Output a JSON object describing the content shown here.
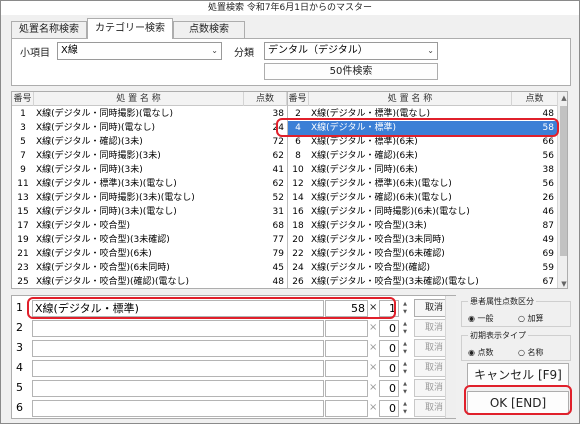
{
  "window": {
    "title": "処置検索 令和7年6月1日からのマスター"
  },
  "tabs": [
    {
      "label": "処置名称検索"
    },
    {
      "label": "カテゴリー検索"
    },
    {
      "label": "点数検索"
    }
  ],
  "filters": {
    "subitem_label": "小項目",
    "subitem_value": "X線",
    "category_label": "分類",
    "category_value": "デンタル（デジタル）",
    "search_button": "50件検索"
  },
  "table": {
    "headers": {
      "no": "番号",
      "name": "処 置 名 称",
      "pts": "点数"
    },
    "left_rows": [
      {
        "no": "1",
        "name": "X線(デジタル・同時撮影)(電なし)",
        "pts": "38"
      },
      {
        "no": "3",
        "name": "X線(デジタル・同時)(電なし)",
        "pts": "24"
      },
      {
        "no": "5",
        "name": "X線(デジタル・確認)(3未)",
        "pts": "72"
      },
      {
        "no": "7",
        "name": "X線(デジタル・同時撮影)(3未)",
        "pts": "62"
      },
      {
        "no": "9",
        "name": "X線(デジタル・同時)(3未)",
        "pts": "41"
      },
      {
        "no": "11",
        "name": "X線(デジタル・標準)(3未)(電なし)",
        "pts": "62"
      },
      {
        "no": "13",
        "name": "X線(デジタル・同時撮影)(3未)(電なし)",
        "pts": "52"
      },
      {
        "no": "15",
        "name": "X線(デジタル・同時)(3未)(電なし)",
        "pts": "31"
      },
      {
        "no": "17",
        "name": "X線(デジタル・咬合型)",
        "pts": "68"
      },
      {
        "no": "19",
        "name": "X線(デジタル・咬合型)(3未確認)",
        "pts": "77"
      },
      {
        "no": "21",
        "name": "X線(デジタル・咬合型)(6未)",
        "pts": "79"
      },
      {
        "no": "23",
        "name": "X線(デジタル・咬合型)(6未同時)",
        "pts": "45"
      },
      {
        "no": "25",
        "name": "X線(デジタル・咬合型)(確認)(電なし)",
        "pts": "48"
      }
    ],
    "right_rows": [
      {
        "no": "2",
        "name": "X線(デジタル・標準)(電なし)",
        "pts": "48"
      },
      {
        "no": "4",
        "name": "X線(デジタル・標準)",
        "pts": "58"
      },
      {
        "no": "6",
        "name": "X線(デジタル・標準)(6未)",
        "pts": "66"
      },
      {
        "no": "8",
        "name": "X線(デジタル・確認)(6未)",
        "pts": "56"
      },
      {
        "no": "10",
        "name": "X線(デジタル・同時)(6未)",
        "pts": "38"
      },
      {
        "no": "12",
        "name": "X線(デジタル・標準)(6未)(電なし)",
        "pts": "56"
      },
      {
        "no": "14",
        "name": "X線(デジタル・確認)(6未)(電なし)",
        "pts": "26"
      },
      {
        "no": "16",
        "name": "X線(デジタル・同時撮影)(6未)(電なし)",
        "pts": "46"
      },
      {
        "no": "18",
        "name": "X線(デジタル・咬合型)(3未)",
        "pts": "87"
      },
      {
        "no": "20",
        "name": "X線(デジタル・咬合型)(3未同時)",
        "pts": "49"
      },
      {
        "no": "22",
        "name": "X線(デジタル・咬合型)(6未確認)",
        "pts": "69"
      },
      {
        "no": "24",
        "name": "X線(デジタル・咬合型)(確認)",
        "pts": "59"
      },
      {
        "no": "26",
        "name": "X線(デジタル・咬合型)(3未確認)(電なし)",
        "pts": "67"
      }
    ]
  },
  "input_rows": [
    {
      "idx": "1",
      "name": "X線(デジタル・標準)",
      "pts": "58",
      "x": "×",
      "qty": "1",
      "cancel": "取消"
    },
    {
      "idx": "2",
      "name": "",
      "pts": "",
      "x": "×",
      "qty": "0",
      "cancel": "取消"
    },
    {
      "idx": "3",
      "name": "",
      "pts": "",
      "x": "×",
      "qty": "0",
      "cancel": "取消"
    },
    {
      "idx": "4",
      "name": "",
      "pts": "",
      "x": "×",
      "qty": "0",
      "cancel": "取消"
    },
    {
      "idx": "5",
      "name": "",
      "pts": "",
      "x": "×",
      "qty": "0",
      "cancel": "取消"
    },
    {
      "idx": "6",
      "name": "",
      "pts": "",
      "x": "×",
      "qty": "0",
      "cancel": "取消"
    }
  ],
  "side": {
    "patient_group": "患者属性点数区分",
    "patient_opt1": "◉ 一般",
    "patient_opt2": "○ 加算",
    "display_group": "初期表示タイプ",
    "display_opt1": "◉ 点数",
    "display_opt2": "○ 名称",
    "cancel_button": "キャンセル [F9]",
    "ok_button": "OK [END]"
  },
  "colors": {
    "selection": "#3b7fd6",
    "highlight": "#e0202b"
  }
}
